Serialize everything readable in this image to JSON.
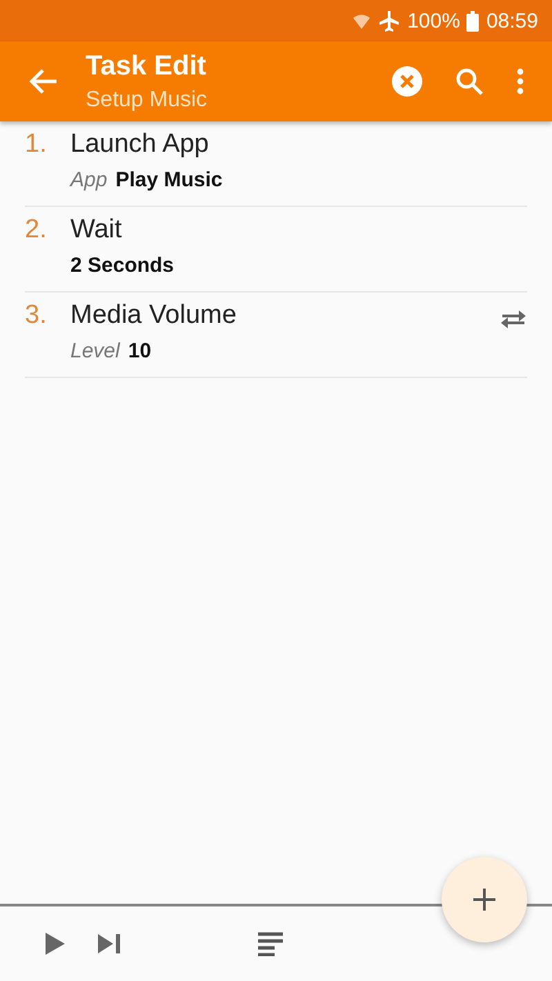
{
  "status_bar": {
    "battery": "100%",
    "time": "08:59"
  },
  "app_bar": {
    "title": "Task Edit",
    "subtitle": "Setup Music"
  },
  "actions": [
    {
      "number": "1.",
      "name": "Launch App",
      "label": "App",
      "value": "Play Music",
      "swap_icon": false
    },
    {
      "number": "2.",
      "name": "Wait",
      "value": "2 Seconds",
      "swap_icon": false
    },
    {
      "number": "3.",
      "name": "Media Volume",
      "label": "Level",
      "value": "10",
      "swap_icon": true
    }
  ]
}
